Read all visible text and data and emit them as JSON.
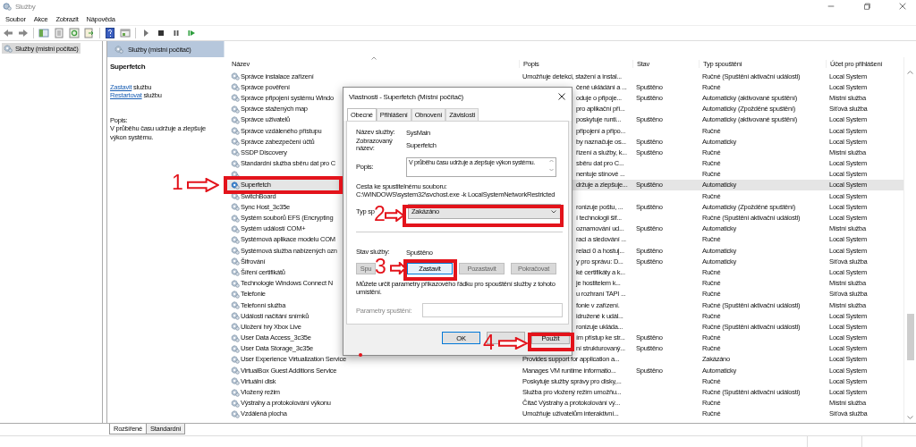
{
  "window": {
    "title": "Služby"
  },
  "menu": [
    "Soubor",
    "Akce",
    "Zobrazit",
    "Nápověda"
  ],
  "tree": {
    "items": [
      {
        "label": "Služby (místní počítač)",
        "selected": true
      }
    ]
  },
  "pane": {
    "title": "Služby (místní počítač)"
  },
  "details": {
    "service": "Superfetch",
    "actions": [
      {
        "link": "Zastavit",
        "text": "službu"
      },
      {
        "link": "Restartovat",
        "text": "službu"
      }
    ],
    "description_label": "Popis:",
    "description": "V průběhu času udržuje a zlepšuje výkon systému."
  },
  "table": {
    "columns": [
      "Název",
      "Popis",
      "Stav",
      "Typ spouštění",
      "Účet pro přihlášení"
    ],
    "rows": [
      {
        "name": "Správce instalace zařízení",
        "description": "Umožňuje detekci, stažení a instal...",
        "startup": "Ručné (Spuštění aktivační události)",
        "account": "Local System",
        "selected": false,
        "covered": false
      },
      {
        "name": "Správce pověření",
        "description": "čené ukládání a ...",
        "status": "Spuštěno",
        "startup": "Ručné",
        "account": "Local System",
        "selected": false,
        "covered": true
      },
      {
        "name": "Správce připojení systému Windo",
        "description": "oduje o připoje...",
        "status": "Spuštěno",
        "startup": "Automaticky (aktivované spuštění)",
        "account": "Místní služba",
        "selected": false,
        "covered": true
      },
      {
        "name": "Správce stažených map",
        "description": "pro aplikační pří...",
        "startup": "Automaticky (Zpožděné spuštění)",
        "account": "Síťová služba",
        "selected": false,
        "covered": true
      },
      {
        "name": "Správce uživatelů",
        "description": "poskytuje runti...",
        "status": "Spuštěno",
        "startup": "Automaticky (aktivované spuštění)",
        "account": "Local System",
        "selected": false,
        "covered": true
      },
      {
        "name": "Správce vzdáleného přístupu",
        "description": "připojení a připo...",
        "startup": "Ručné",
        "account": "Local System",
        "selected": false,
        "covered": true
      },
      {
        "name": "Správce zabezpečení účtů",
        "description": "by naznačuje os...",
        "status": "Spuštěno",
        "startup": "Automaticky",
        "account": "Local System",
        "selected": false,
        "covered": true
      },
      {
        "name": "SSDP Discovery",
        "description": "řízení a služby, k...",
        "status": "Spuštěno",
        "startup": "Ručné",
        "account": "Místní služba",
        "selected": false,
        "covered": true
      },
      {
        "name": "Standardní služba sběru dat pro C",
        "description": "sběru dat pro C...",
        "startup": "Ručné",
        "account": "Local System",
        "selected": false,
        "covered": true
      },
      {
        "description": "nentuje stínové ...",
        "startup": "Ručné",
        "account": "Local System",
        "selected": false,
        "covered": true
      },
      {
        "name": "Superfetch",
        "description": "držuje a zlepšuje...",
        "status": "Spuštěno",
        "startup": "Automaticky",
        "account": "Local System",
        "selected": true,
        "covered": true
      },
      {
        "name": "SwitchBoard",
        "startup": "Ručné",
        "account": "Local System",
        "selected": false
      },
      {
        "name": "Sync Host_3c35e",
        "description": "ronizuje poštu, ...",
        "status": "Spuštěno",
        "startup": "Automaticky (Zpožděné spuštění)",
        "account": "Local System",
        "selected": false,
        "covered": true
      },
      {
        "name": "Systém souborů EFS (Encrypting",
        "description": "í technologii šif...",
        "startup": "Ručné (Spuštění aktivační události)",
        "account": "Local System",
        "selected": false,
        "covered": true
      },
      {
        "name": "Systém událostí COM+",
        "description": "oznamování ud...",
        "status": "Spuštěno",
        "startup": "Automaticky",
        "account": "Místní služba",
        "selected": false,
        "covered": true
      },
      {
        "name": "Systémová aplikace modelu COM",
        "description": "raci a sledování ...",
        "startup": "Ručné",
        "account": "Local System",
        "selected": false,
        "covered": true
      },
      {
        "name": "Systémová služba nabízených ozn",
        "description": "relaci 0 a hostuj...",
        "status": "Spuštěno",
        "startup": "Automaticky",
        "account": "Local System",
        "selected": false,
        "covered": true
      },
      {
        "name": "Šifrování",
        "description": "y pro správu: D...",
        "status": "Spuštěno",
        "startup": "Automaticky",
        "account": "Síťová služba",
        "selected": false,
        "covered": true
      },
      {
        "name": "Šíření certifikátů",
        "description": "ké certifikáty a k...",
        "startup": "Ručné",
        "account": "Local System",
        "selected": false,
        "covered": true
      },
      {
        "name": "Technologie Windows Connect N",
        "description": "je hostitelem k...",
        "startup": "Ručné",
        "account": "Místní služba",
        "selected": false,
        "covered": true
      },
      {
        "name": "Telefonie",
        "description": "u rozhraní TAPI ...",
        "startup": "Ručné",
        "account": "Síťová služba",
        "selected": false,
        "covered": true
      },
      {
        "name": "Telefonní služba",
        "description": "fonie v zařízení.",
        "startup": "Ručné (Spuštění aktivační události)",
        "account": "Místní služba",
        "selected": false,
        "covered": true
      },
      {
        "name": "Události načítání snímků",
        "description": "idružené k udál...",
        "startup": "Ručné",
        "account": "Local System",
        "selected": false,
        "covered": true
      },
      {
        "name": "Uložení hry Xbox Live",
        "description": "ronizuje ukláda...",
        "startup": "Ručné (Spuštění aktivační události)",
        "account": "Local System",
        "selected": false,
        "covered": true
      },
      {
        "name": "User Data Access_3c35e",
        "description": "ím přístup ke str...",
        "status": "Spuštěno",
        "startup": "Ručné",
        "account": "Local System",
        "selected": false,
        "covered": true
      },
      {
        "name": "User Data Storage_3c35e",
        "description": "ní strukturovaný...",
        "status": "Spuštěno",
        "startup": "Ručné",
        "account": "Local System",
        "selected": false,
        "covered": true
      },
      {
        "name": "User Experience Virtualization Service",
        "description": "Provides support for application a...",
        "startup": "Zakázáno",
        "account": "Local System",
        "selected": false,
        "covered": false
      },
      {
        "name": "VirtualBox Guest Additions Service",
        "description": "Manages VM runtime informatio...",
        "status": "Spuštěno",
        "startup": "Automaticky",
        "account": "Local System",
        "selected": false,
        "covered": false
      },
      {
        "name": "Virtuální disk",
        "description": "Poskytuje služby správy pro disky,...",
        "startup": "Ručné",
        "account": "Local System",
        "selected": false,
        "covered": false
      },
      {
        "name": "Vložený režim",
        "description": "Služba pro vložený režim umožňu...",
        "startup": "Ručné (Spuštění aktivační události)",
        "account": "Local System",
        "selected": false,
        "covered": false
      },
      {
        "name": "Výstrahy a protokolování výkonu",
        "description": "Čítač Výstrahy a protokolování vý...",
        "startup": "Ručné",
        "account": "Místní služba",
        "selected": false,
        "covered": false
      },
      {
        "name": "Vzdálená plocha",
        "description": "Umožňuje uživatelům interaktivní...",
        "startup": "Ručné",
        "account": "Síťová služba",
        "selected": false,
        "covered": false
      }
    ]
  },
  "view_tabs": [
    {
      "label": "Rozšířené",
      "selected": true
    },
    {
      "label": "Standardní",
      "selected": false
    }
  ],
  "dialog": {
    "title": "Vlastnosti - Superfetch (Místní počítač)",
    "tabs": [
      {
        "label": "Obecné",
        "selected": true
      },
      {
        "label": "Přihlášení",
        "selected": false
      },
      {
        "label": "Obnovení",
        "selected": false
      },
      {
        "label": "Závislosti",
        "selected": false
      }
    ],
    "fields": [
      {
        "label": "Název služby:",
        "value": "SysMain"
      },
      {
        "label": "Zobrazovaný název:",
        "value": "Superfetch"
      }
    ],
    "description": {
      "label": "Popis:",
      "value": "V průběhu času udržuje a zlepšuje výkon systému."
    },
    "path": {
      "label": "Cesta ke spustitelnému souboru:",
      "value": "C:\\WINDOWS\\system32\\svchost.exe -k LocalSystemNetworkRestricted"
    },
    "startup": {
      "label": "Typ sp",
      "value": "Zakázáno"
    },
    "status": {
      "label": "Stav služby:",
      "value": "Spuštěno"
    },
    "control_buttons": [
      {
        "label": "Spu",
        "disabled": true
      },
      {
        "label": "Zastavit",
        "disabled": false
      },
      {
        "label": "Pozastavit",
        "disabled": true
      },
      {
        "label": "Pokračovat",
        "disabled": true
      }
    ],
    "note": "Můžete určit parametry příkazového řádku pro spouštění služby z tohoto umístění.",
    "params": {
      "label": "Parametry spuštění:",
      "disabled": true
    },
    "buttons": [
      {
        "label": "OK",
        "default": true
      },
      {
        "default": false
      },
      {
        "label": "Použít",
        "default": false
      }
    ]
  },
  "annotations": [
    {
      "label": "1"
    },
    {
      "label": "2"
    },
    {
      "label": "3"
    },
    {
      "label": "4"
    }
  ]
}
